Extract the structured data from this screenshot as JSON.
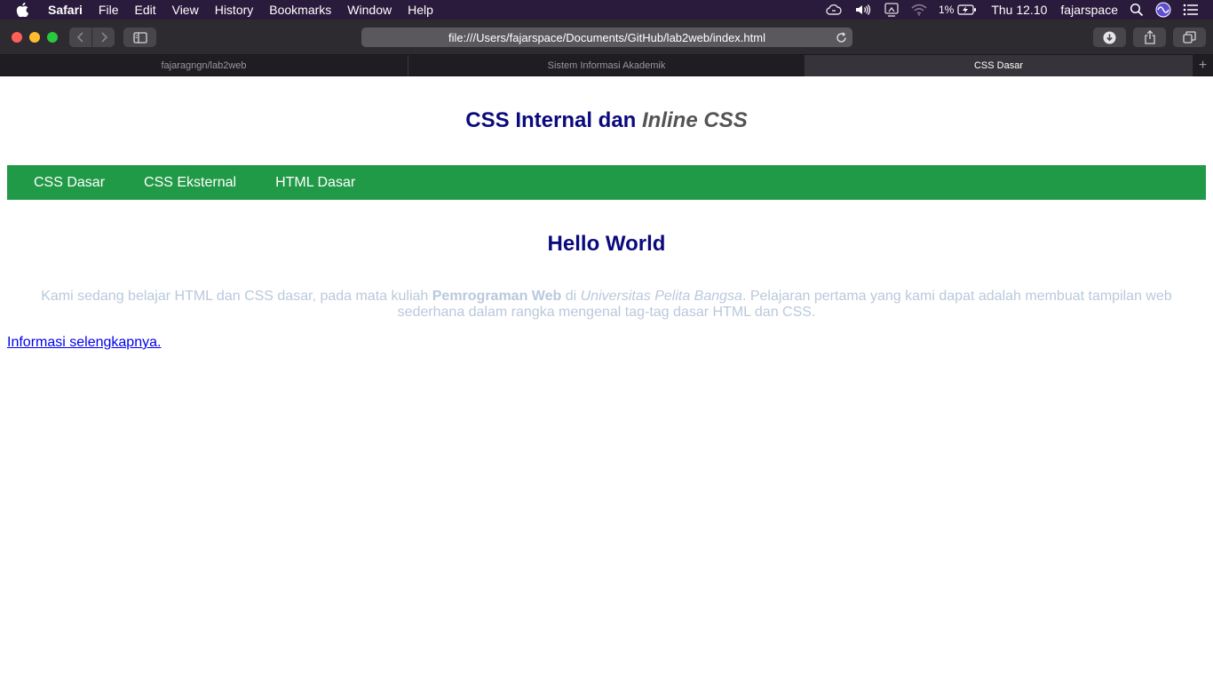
{
  "menubar": {
    "app_name": "Safari",
    "items": [
      "File",
      "Edit",
      "View",
      "History",
      "Bookmarks",
      "Window",
      "Help"
    ],
    "battery": "1%",
    "clock": "Thu 12.10",
    "user": "fajarspace"
  },
  "toolbar": {
    "url": "file:///Users/fajarspace/Documents/GitHub/lab2web/index.html"
  },
  "tabs": [
    {
      "label": "fajaragngn/lab2web"
    },
    {
      "label": "Sistem Informasi Akademik"
    },
    {
      "label": "CSS Dasar"
    }
  ],
  "page": {
    "title_part1": "CSS Internal dan",
    "title_part2": "Inline CSS",
    "nav": [
      "CSS Dasar",
      "CSS Eksternal",
      "HTML Dasar"
    ],
    "heading": "Hello World",
    "intro": {
      "t1": "Kami sedang belajar HTML dan CSS dasar, pada mata kuliah ",
      "bold": "Pemrograman Web",
      "t2": " di ",
      "italic": "Universitas Pelita Bangsa",
      "t3": ". Pelajaran pertama yang kami dapat adalah membuat tampilan web sederhana dalam rangka mengenal tag-tag dasar HTML dan CSS."
    },
    "more_link": "Informasi selengkapnya."
  },
  "colors": {
    "menubar_bg": "#2a1a3c",
    "nav_green": "#219a47",
    "heading_navy": "#0a0a7d",
    "intro_text": "#b9c9dc",
    "link_blue": "#0000ee"
  }
}
